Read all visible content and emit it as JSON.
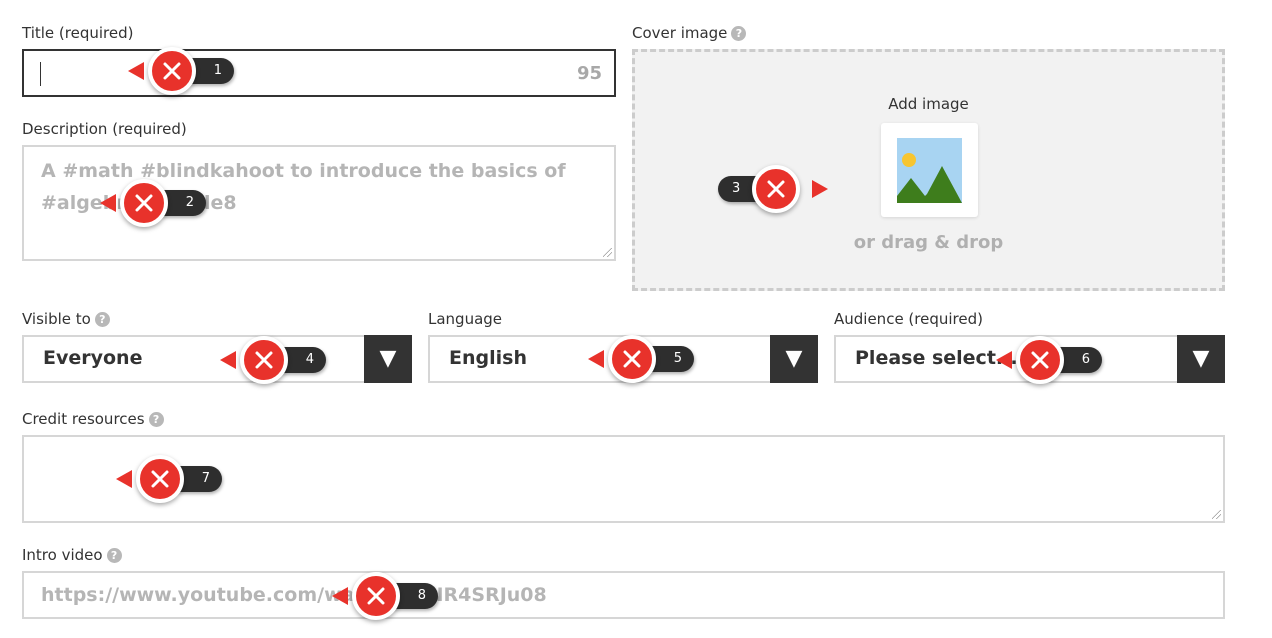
{
  "title_field": {
    "label": "Title (required)",
    "value": "",
    "counter": "95"
  },
  "description_field": {
    "label": "Description (required)",
    "placeholder_line1": "A #math #blindkahoot to introduce the basics of",
    "placeholder_line2": "#algebra #grade8"
  },
  "cover_image": {
    "label": "Cover image",
    "add_label": "Add image",
    "drag_label": "or drag & drop"
  },
  "visible_to": {
    "label": "Visible to",
    "value": "Everyone"
  },
  "language": {
    "label": "Language",
    "value": "English"
  },
  "audience": {
    "label": "Audience (required)",
    "value": "Please select..."
  },
  "credit_resources": {
    "label": "Credit resources",
    "value": ""
  },
  "intro_video": {
    "label": "Intro video",
    "placeholder": "https://www.youtube.com/watch?v=NR4SRJu08"
  },
  "help_glyph": "?",
  "dropdown_glyph": "▼",
  "markers": [
    "1",
    "2",
    "3",
    "4",
    "5",
    "6",
    "7",
    "8"
  ],
  "colors": {
    "accent_red": "#e8322b",
    "dark": "#333333",
    "border": "#d6d6d6",
    "placeholder": "#b5b5b5"
  }
}
